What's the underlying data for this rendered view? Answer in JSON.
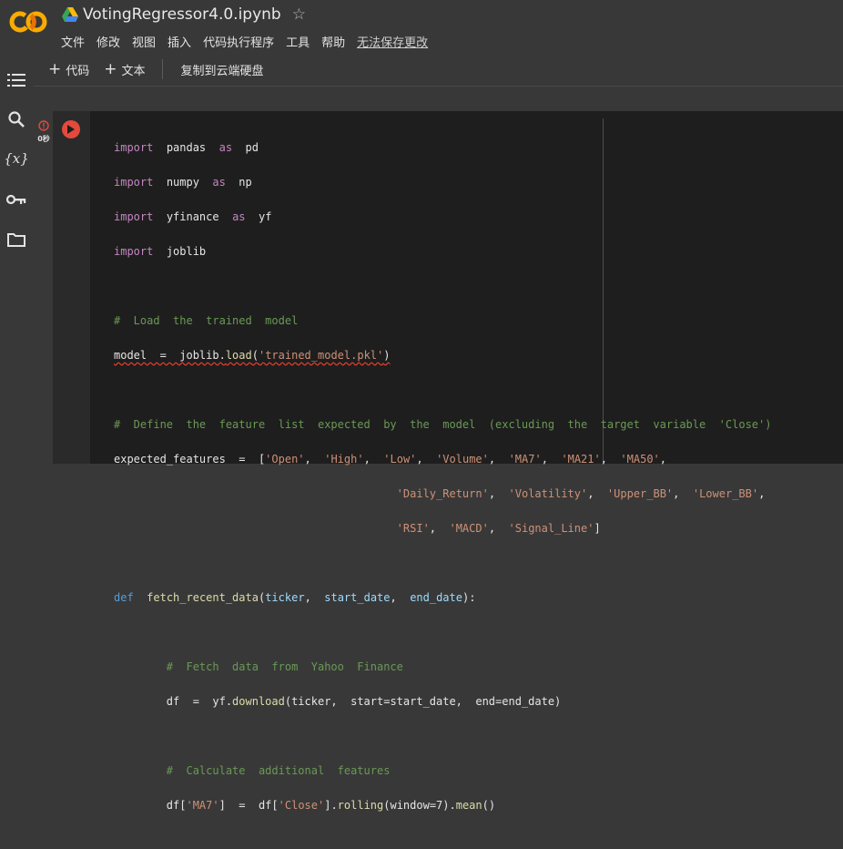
{
  "app": {
    "doc_title": "VotingRegressor4.0.ipynb",
    "star_glyph": "☆",
    "menu": [
      "文件",
      "修改",
      "视图",
      "插入",
      "代码执行程序",
      "工具",
      "帮助"
    ],
    "unsaved_label": "无法保存更改"
  },
  "toolbar": {
    "add_code_label": "代码",
    "add_text_label": "文本",
    "copy_to_drive_label": "复制到云端硬盘"
  },
  "cell": {
    "exec_time": "0秒",
    "status_color": "#e34a3c"
  },
  "code": {
    "line1": {
      "kw1": "import",
      "mod": "pandas",
      "kw2": "as",
      "alias": "pd"
    },
    "line2": {
      "kw1": "import",
      "mod": "numpy",
      "kw2": "as",
      "alias": "np"
    },
    "line3": {
      "kw1": "import",
      "mod": "yfinance",
      "kw2": "as",
      "alias": "yf"
    },
    "line4": {
      "kw1": "import",
      "mod": "joblib"
    },
    "comment_load": "#  Load  the  trained  model",
    "line_model": {
      "lhs": "model  =  joblib.",
      "fn": "load",
      "open": "(",
      "str": "'trained_model.pkl'",
      "close": ")"
    },
    "comment_define": "#  Define  the  feature  list  expected  by  the  model  (excluding  the  target  variable  'Close')",
    "features_lhs": "expected_features  =  [",
    "features_row1": [
      {
        "str": "'Open'",
        "sep": ",  "
      },
      {
        "str": "'High'",
        "sep": ",  "
      },
      {
        "str": "'Low'",
        "sep": ",  "
      },
      {
        "str": "'Volume'",
        "sep": ",  "
      },
      {
        "str": "'MA7'",
        "sep": ",  "
      },
      {
        "str": "'MA21'",
        "sep": ",  "
      },
      {
        "str": "'MA50'",
        "sep": ","
      }
    ],
    "features_row2": [
      {
        "str": "'Daily_Return'",
        "sep": ",  "
      },
      {
        "str": "'Volatility'",
        "sep": ",  "
      },
      {
        "str": "'Upper_BB'",
        "sep": ",  "
      },
      {
        "str": "'Lower_BB'",
        "sep": ","
      }
    ],
    "features_row3": [
      {
        "str": "'RSI'",
        "sep": ",  "
      },
      {
        "str": "'MACD'",
        "sep": ",  "
      },
      {
        "str": "'Signal_Line'",
        "sep": "]"
      }
    ],
    "def_line": {
      "kw": "def",
      "fn": "fetch_recent_data",
      "p1": "ticker",
      "p2": "start_date",
      "p3": "end_date"
    },
    "comment_fetch": "#  Fetch  data  from  Yahoo  Finance",
    "download_line": {
      "lhs": "df  =  yf.",
      "fn": "download",
      "rest": "(ticker,  start=start_date,  end=end_date)"
    },
    "comment_calc": "#  Calculate  additional  features",
    "ma7_line": {
      "a": "df[",
      "s1": "'MA7'",
      "b": "]  =  df[",
      "s2": "'Close'",
      "c": "].",
      "fn1": "rolling",
      "d": "(window=7).",
      "fn2": "mean",
      "e": "()"
    }
  }
}
